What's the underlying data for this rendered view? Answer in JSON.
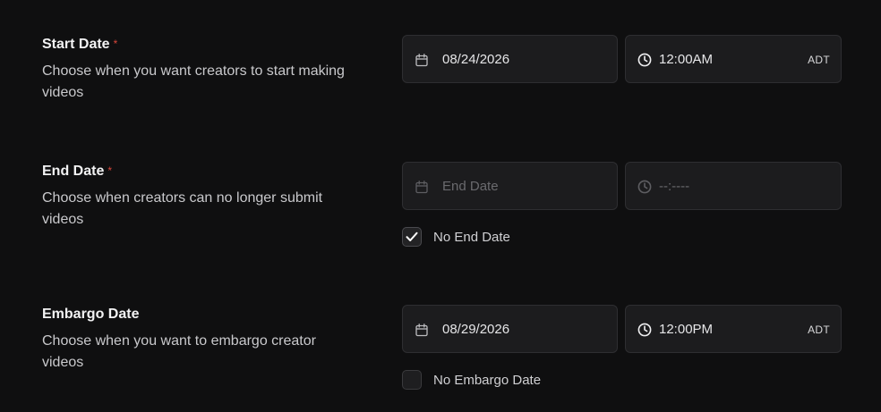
{
  "sections": [
    {
      "title": "Start Date",
      "required_mark": "*",
      "description": "Choose when you want creators to start making videos",
      "date": {
        "value": "08/24/2026",
        "placeholder": ""
      },
      "time": {
        "value": "12:00AM",
        "placeholder": "",
        "timezone": "ADT"
      }
    },
    {
      "title": "End Date",
      "required_mark": "*",
      "description": "Choose when creators can no longer submit videos",
      "date": {
        "value": "",
        "placeholder": "End Date"
      },
      "time": {
        "value": "",
        "placeholder": "--:----",
        "timezone": ""
      },
      "checkbox": {
        "label": "No End Date",
        "checked": true
      }
    },
    {
      "title": "Embargo Date",
      "required_mark": "",
      "description": "Choose when you want to embargo creator videos",
      "date": {
        "value": "08/29/2026",
        "placeholder": ""
      },
      "time": {
        "value": "12:00PM",
        "placeholder": "",
        "timezone": "ADT"
      },
      "checkbox": {
        "label": "No Embargo Date",
        "checked": false
      }
    }
  ],
  "icons": {
    "date": "calendar-icon",
    "time": "clock-icon",
    "check": "checkmark-icon"
  },
  "colors": {
    "background": "#0f0f10",
    "field_bg": "#1c1c1e",
    "required": "#d9463b"
  }
}
